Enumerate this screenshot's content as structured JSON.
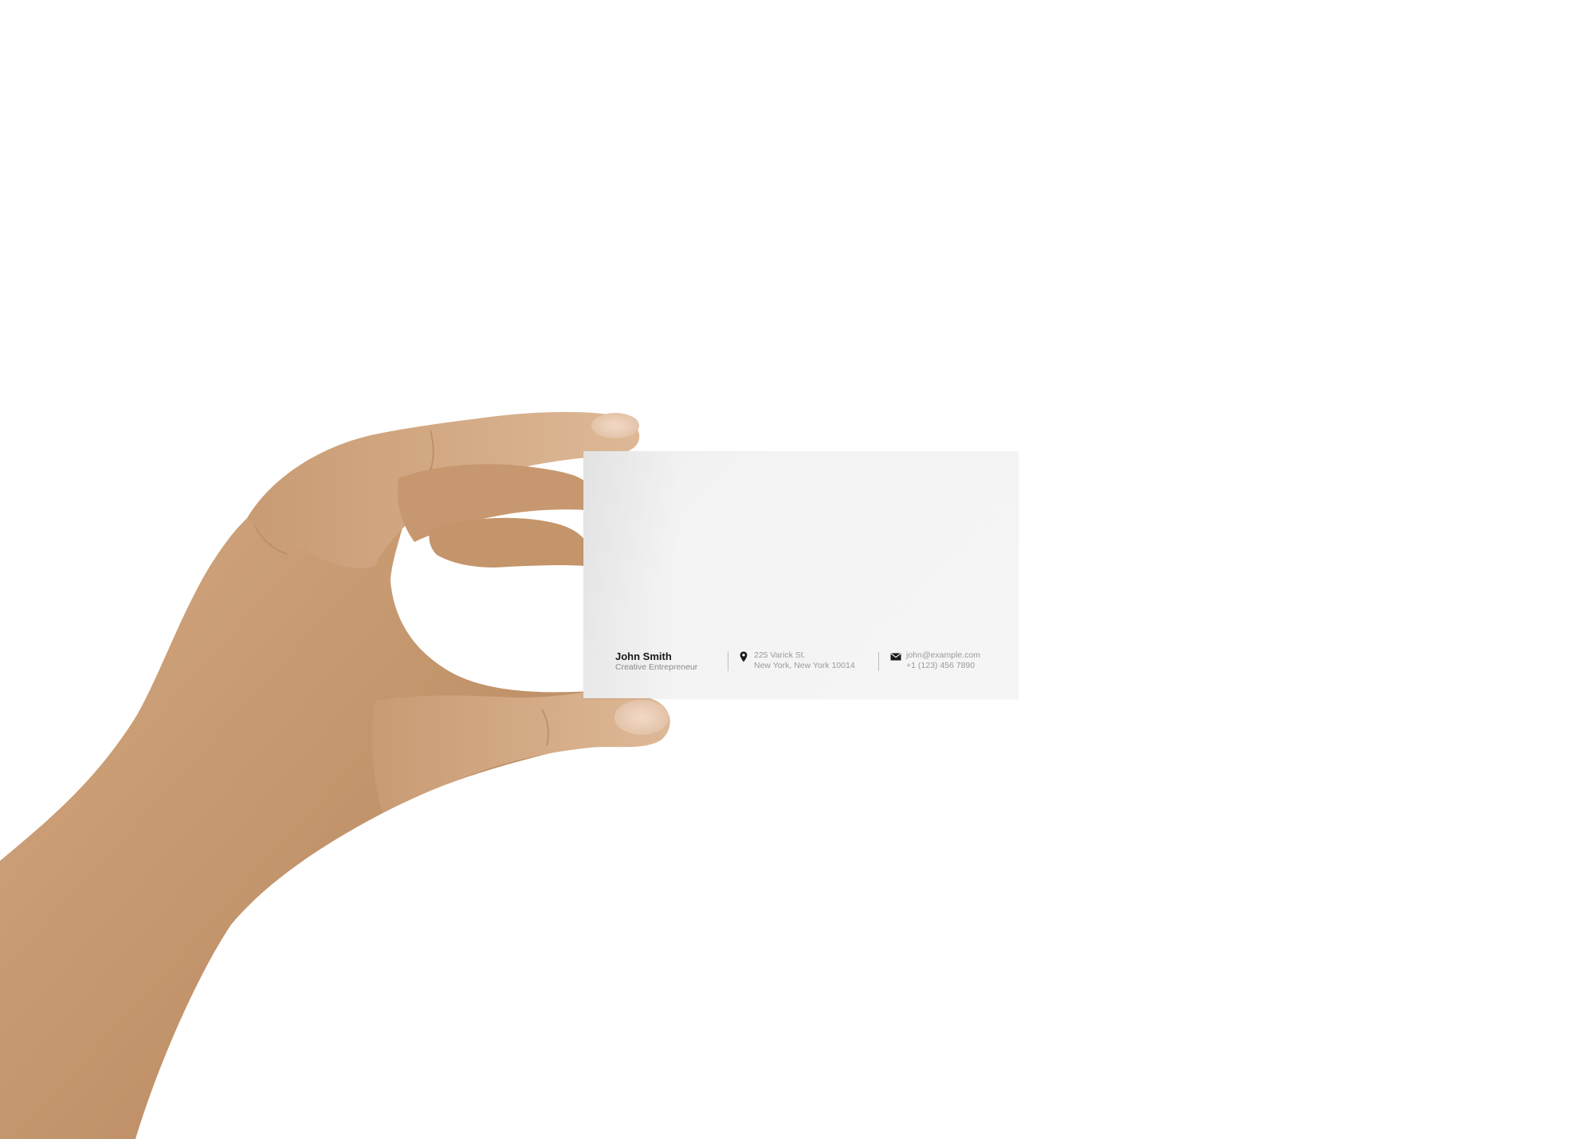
{
  "card": {
    "name": "John Smith",
    "role": "Creative Entrepreneur",
    "address": {
      "icon": "location-pin-icon",
      "line1": "225 Varick St.",
      "line2": "New York, New York 10014"
    },
    "contact": {
      "icon": "envelope-icon",
      "email": "john@example.com",
      "phone": "+1 (123) 456 7890"
    }
  },
  "colors": {
    "background": "#ffffff",
    "card": "#f4f4f4",
    "skin": "#c89a72",
    "name_text": "#1a1a1a",
    "secondary_text": "#9a9a9a"
  }
}
